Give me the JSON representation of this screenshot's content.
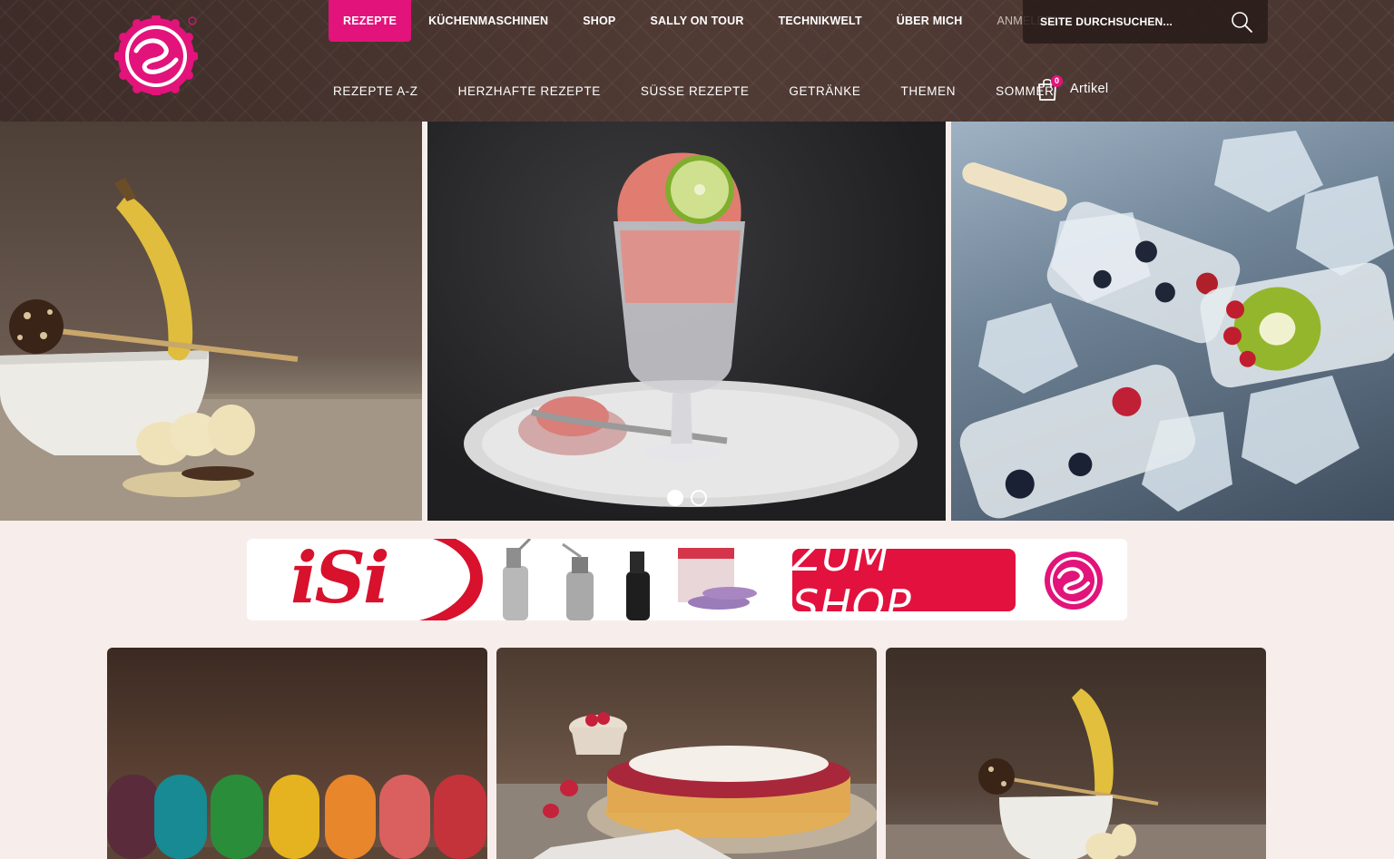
{
  "brand": {
    "logo_text": "Sallys",
    "accent_color": "#e2137a"
  },
  "top_nav": [
    {
      "label": "REZEPTE",
      "active": true
    },
    {
      "label": "KÜCHENMASCHINEN",
      "active": false
    },
    {
      "label": "SHOP",
      "active": false
    },
    {
      "label": "SALLY ON TOUR",
      "active": false
    },
    {
      "label": "TECHNIKWELT",
      "active": false
    },
    {
      "label": "ÜBER MICH",
      "active": false
    },
    {
      "label": "ANMELDEN",
      "active": false
    }
  ],
  "search": {
    "placeholder": "SEITE DURCHSUCHEN...",
    "icon": "search-icon"
  },
  "main_nav": [
    {
      "label": "REZEPTE A-Z"
    },
    {
      "label": "HERZHAFTE REZEPTE"
    },
    {
      "label": "SÜSSE REZEPTE"
    },
    {
      "label": "GETRÄNKE"
    },
    {
      "label": "THEMEN"
    },
    {
      "label": "SOMMER"
    }
  ],
  "cart": {
    "count": "0",
    "label": "Artikel",
    "icon": "shopping-bag-icon"
  },
  "hero": {
    "slides": [
      {
        "subject": "banana-chocolate-bowl"
      },
      {
        "subject": "granita-glass"
      },
      {
        "subject": "fruit-ice-pops"
      }
    ],
    "dots": [
      {
        "active": true
      },
      {
        "active": false
      }
    ]
  },
  "banner": {
    "brand": "iSi",
    "cta": "ZUM SHOP",
    "logo_text": "Sallys",
    "brand_color": "#d8112c"
  },
  "cards": [
    {
      "subject": "macarons"
    },
    {
      "subject": "raspberry-cream-cake"
    },
    {
      "subject": "banana-chocolate-bowl"
    }
  ]
}
